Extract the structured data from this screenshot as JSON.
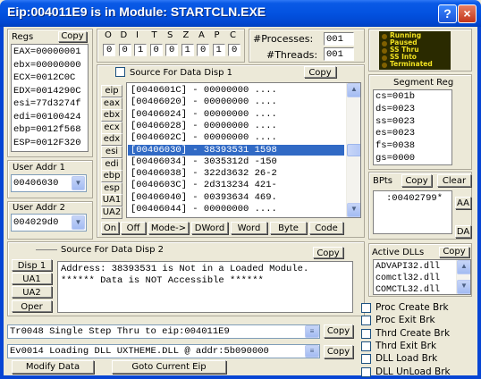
{
  "window": {
    "title": "Eip:004011E9 is in Module: STARTCLN.EXE",
    "help_label": "?",
    "close_label": "×"
  },
  "regs": {
    "title": "Regs",
    "copy_label": "Copy",
    "lines": [
      "EAX=00000001",
      "ebx=00000000",
      "ECX=0012C0C",
      "EDX=0014290C",
      "esi=77d3274f",
      "edi=00100424",
      "ebp=0012f568",
      "ESP=0012F320"
    ]
  },
  "flags": {
    "letters": [
      "O",
      "D",
      "I",
      "T",
      "S",
      "Z",
      "A",
      "P",
      "C"
    ],
    "values": [
      "0",
      "0",
      "1",
      "0",
      "0",
      "1",
      "0",
      "1",
      "0"
    ]
  },
  "counters": {
    "processes_label": "#Processes:",
    "processes_value": "001",
    "threads_label": "#Threads:",
    "threads_value": "001"
  },
  "status": {
    "items": [
      {
        "label": "Running",
        "color": "#806000"
      },
      {
        "label": "Paused",
        "color": "#806000"
      },
      {
        "label": "SS Thru",
        "color": "#806000"
      },
      {
        "label": "SS Into",
        "color": "#806000"
      },
      {
        "label": "Terminated",
        "color": "#806000"
      }
    ]
  },
  "user_addr_1": {
    "label": "User Addr 1",
    "value": "00406030"
  },
  "user_addr_2": {
    "label": "User Addr 2",
    "value": "004029d0"
  },
  "disp1": {
    "title": "Source For Data Disp 1",
    "copy_label": "Copy",
    "reg_buttons": [
      "eip",
      "eax",
      "ebx",
      "ecx",
      "edx",
      "esi",
      "edi",
      "ebp",
      "esp",
      "UA1",
      "UA2"
    ],
    "lines": [
      "[0040601C] - 00000000  ....",
      "[00406020] - 00000000  ....",
      "[00406024] - 00000000  ....",
      "[00406028] - 00000000  ....",
      "[0040602C] - 00000000  ....",
      "[00406030] - 38393531  1598",
      "[00406034] - 3035312d  -150",
      "[00406038] - 322d3632  26-2",
      "[0040603C] - 2d313234  421-",
      "[00406040] - 00393634  469.",
      "[00406044] - 00000000  ...."
    ],
    "selected_index": 5,
    "mode_buttons": [
      "On",
      "Off",
      "Mode->",
      "DWord",
      "Word",
      "Byte",
      "Code"
    ]
  },
  "segment": {
    "title": "Segment Reg",
    "lines": [
      "cs=001b",
      "ds=0023",
      "ss=0023",
      "es=0023",
      "fs=0038",
      "gs=0000"
    ]
  },
  "bpts": {
    "label": "BPts",
    "copy_label": "Copy",
    "clear_label": "Clear",
    "items": [
      ":00402799*"
    ],
    "aa_label": "AA",
    "da_label": "DA"
  },
  "disp2": {
    "title": "Source For Data Disp 2",
    "copy_label": "Copy",
    "buttons": [
      "Disp 1",
      "UA1",
      "UA2",
      "Oper"
    ],
    "lines": [
      "Address: 38393531 is Not in a Loaded Module.",
      "****** Data is NOT Accessible ******"
    ]
  },
  "dlls": {
    "title": "Active DLLs",
    "copy_label": "Copy",
    "items": [
      "ADVAPI32.dll",
      "comctl32.dll",
      "COMCTL32.dll"
    ]
  },
  "log": {
    "line1": "Tr0048 Single Step Thru to eip:004011E9",
    "line2": "Ev0014 Loading DLL UXTHEME.DLL @ addr:5b090000",
    "copy_label": "Copy"
  },
  "checks": [
    "Proc Create Brk",
    "Proc Exit Brk",
    "Thrd Create Brk",
    "Thrd Exit Brk",
    "DLL Load Brk",
    "DLL UnLoad Brk"
  ],
  "bottom_buttons": {
    "modify": "Modify Data",
    "goto": "Goto Current Eip"
  }
}
